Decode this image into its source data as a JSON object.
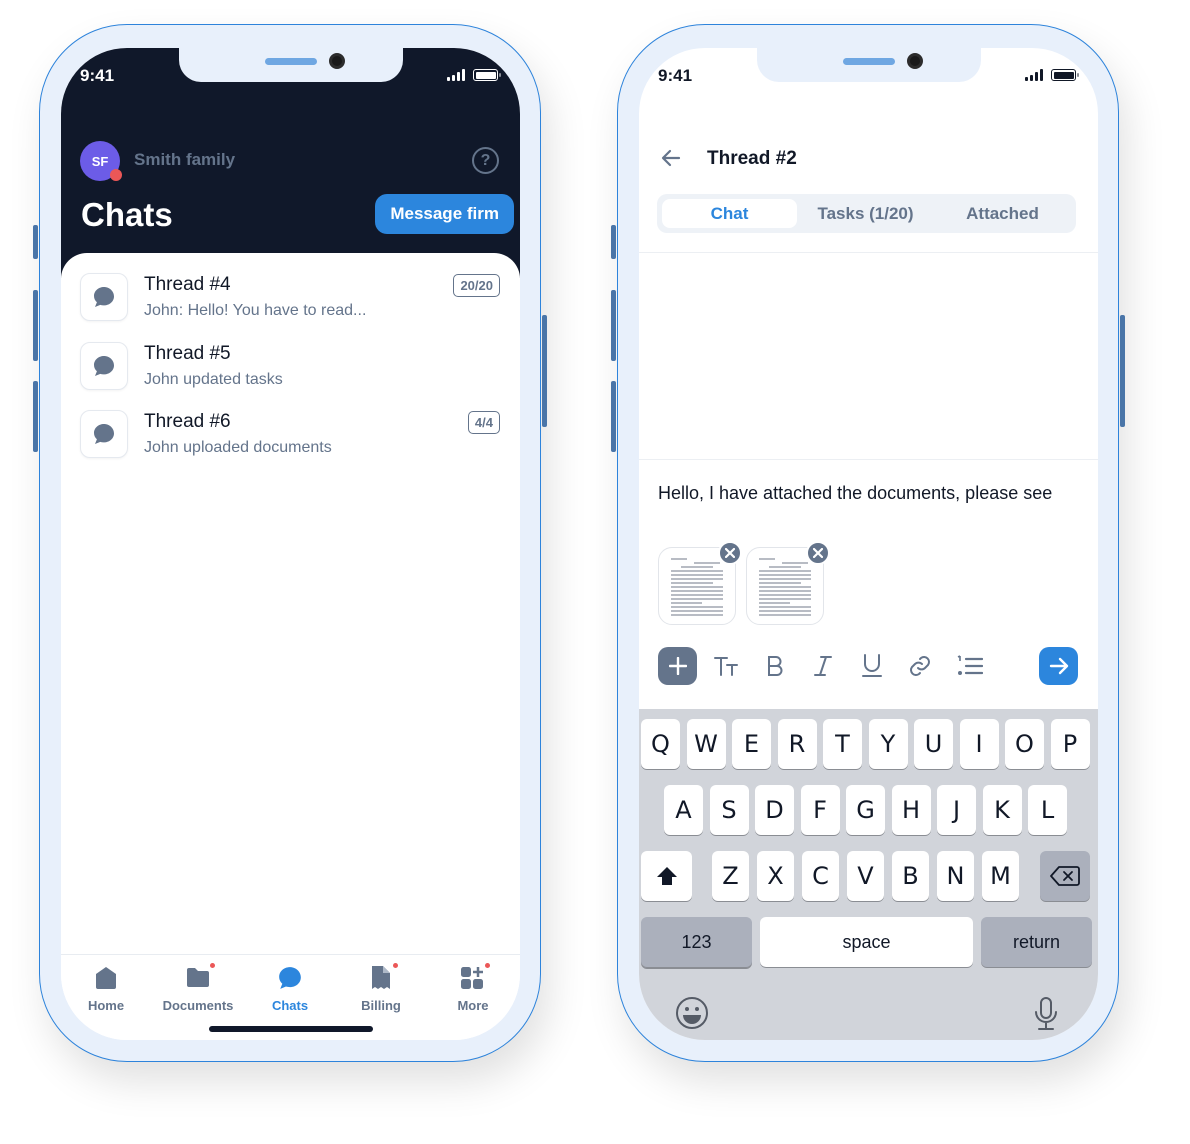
{
  "status_bar": {
    "time": "9:41"
  },
  "chats_screen": {
    "account_initials": "SF",
    "account_name": "Smith family",
    "help_icon": "question-circle-icon",
    "title": "Chats",
    "message_firm_label": "Message firm",
    "threads": [
      {
        "name": "Thread #4",
        "preview": "John: Hello! You have to read...",
        "badge": "20/20"
      },
      {
        "name": "Thread #5",
        "preview": "John updated tasks",
        "badge": null
      },
      {
        "name": "Thread #6",
        "preview": "John uploaded documents",
        "badge": "4/4"
      }
    ],
    "tabbar": [
      {
        "label": "Home",
        "icon": "home-icon",
        "active": false,
        "notification": false
      },
      {
        "label": "Documents",
        "icon": "folder-icon",
        "active": false,
        "notification": true
      },
      {
        "label": "Chats",
        "icon": "chat-bubble-icon",
        "active": true,
        "notification": false
      },
      {
        "label": "Billing",
        "icon": "receipt-icon",
        "active": false,
        "notification": true
      },
      {
        "label": "More",
        "icon": "grid-plus-icon",
        "active": false,
        "notification": true
      }
    ]
  },
  "thread_screen": {
    "title": "Thread #2",
    "tabs": [
      {
        "label": "Chat",
        "active": true
      },
      {
        "label": "Tasks (1/20)",
        "active": false
      },
      {
        "label": "Attached",
        "active": false
      }
    ],
    "compose_text": "Hello, I have attached the documents, please see",
    "attachments_count": 2,
    "toolbar": [
      "add",
      "text-size",
      "bold",
      "italic",
      "underline",
      "link",
      "numbered-list",
      "send"
    ],
    "keyboard": {
      "row1": [
        "Q",
        "W",
        "E",
        "R",
        "T",
        "Y",
        "U",
        "I",
        "O",
        "P"
      ],
      "row2": [
        "A",
        "S",
        "D",
        "F",
        "G",
        "H",
        "J",
        "K",
        "L"
      ],
      "row3": [
        "Z",
        "X",
        "C",
        "V",
        "B",
        "N",
        "M"
      ],
      "numbers_label": "123",
      "space_label": "space",
      "return_label": "return"
    }
  },
  "colors": {
    "accent": "#2c86dd",
    "header_dark": "#10182a",
    "muted": "#64748b",
    "avatar": "#6c5ce7",
    "notification": "#eb5757",
    "frame": "#e8f0fb"
  }
}
